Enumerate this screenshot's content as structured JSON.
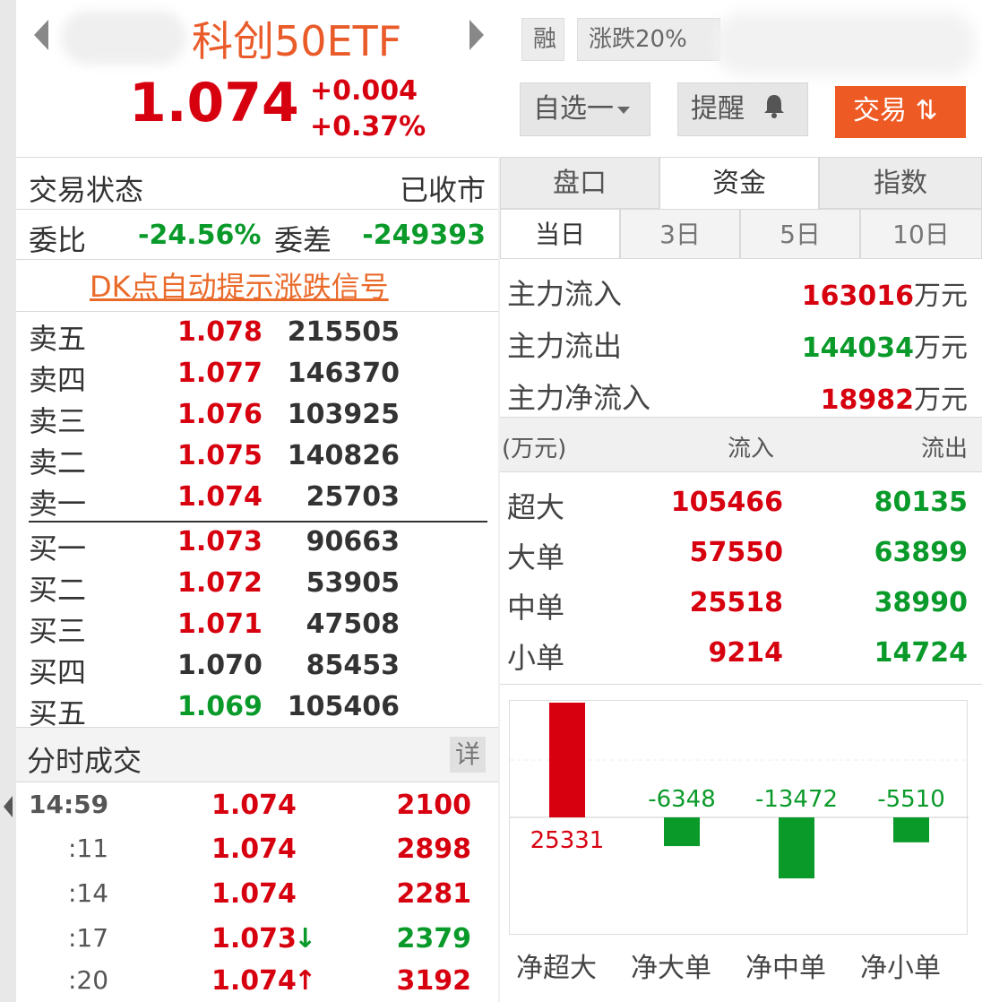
{
  "header": {
    "stock_name": "科创50ETF",
    "price": "1.074",
    "change_abs": "+0.004",
    "change_pct": "+0.37%",
    "tag_rong": "融",
    "tag_zhangdie": "涨跌20%",
    "watchlist_label": "自选一",
    "remind_label": "提醒",
    "trade_label": "交易 ⇅"
  },
  "status": {
    "trade_status_label": "交易状态",
    "trade_status_value": "已收市",
    "weibi_label": "委比",
    "weibi_value": "-24.56%",
    "weicha_label": "委差",
    "weicha_value": "-249393"
  },
  "dk_link": "DK点自动提示涨跌信号",
  "orderbook": {
    "sell": [
      {
        "name": "卖五",
        "price": "1.078",
        "vol": "215505"
      },
      {
        "name": "卖四",
        "price": "1.077",
        "vol": "146370"
      },
      {
        "name": "卖三",
        "price": "1.076",
        "vol": "103925"
      },
      {
        "name": "卖二",
        "price": "1.075",
        "vol": "140826"
      },
      {
        "name": "卖一",
        "price": "1.074",
        "vol": "25703"
      }
    ],
    "buy": [
      {
        "name": "买一",
        "price": "1.073",
        "vol": "90663"
      },
      {
        "name": "买二",
        "price": "1.072",
        "vol": "53905"
      },
      {
        "name": "买三",
        "price": "1.071",
        "vol": "47508"
      },
      {
        "name": "买四",
        "price": "1.070",
        "vol": "85453"
      },
      {
        "name": "买五",
        "price": "1.069",
        "vol": "105406"
      }
    ]
  },
  "ticks": {
    "title": "分时成交",
    "detail_label": "详",
    "rows": [
      {
        "time": "14:59",
        "price": "1.074",
        "vol": "2100"
      },
      {
        "time": ":11",
        "price": "1.074",
        "vol": "2898"
      },
      {
        "time": ":14",
        "price": "1.074",
        "vol": "2281"
      },
      {
        "time": ":17",
        "price": "1.073",
        "vol": "2379"
      },
      {
        "time": ":20",
        "price": "1.074",
        "vol": "3192"
      }
    ]
  },
  "tabs": [
    "盘口",
    "资金",
    "指数"
  ],
  "subtabs": [
    "当日",
    "3日",
    "5日",
    "10日"
  ],
  "flow": {
    "inflow_label": "主力流入",
    "inflow_value": "163016",
    "outflow_label": "主力流出",
    "outflow_value": "144034",
    "net_label": "主力净流入",
    "net_value": "18982",
    "unit": "万元"
  },
  "flow_table": {
    "unit_header": "(万元)",
    "in_header": "流入",
    "out_header": "流出",
    "rows": [
      {
        "label": "超大",
        "in": "105466",
        "out": "80135"
      },
      {
        "label": "大单",
        "in": "57550",
        "out": "63899"
      },
      {
        "label": "中单",
        "in": "25518",
        "out": "38990"
      },
      {
        "label": "小单",
        "in": "9214",
        "out": "14724"
      }
    ]
  },
  "chart_data": {
    "type": "bar",
    "categories": [
      "净超大",
      "净大单",
      "净中单",
      "净小单"
    ],
    "values": [
      25331,
      -6348,
      -13472,
      -5510
    ],
    "colors": {
      "positive": "#d7000f",
      "negative": "#0a9a2a"
    },
    "title": "",
    "xlabel": "",
    "ylabel": ""
  },
  "colors": {
    "up": "#d7000f",
    "down": "#0a9a2a",
    "accent": "#ea5b2a",
    "trade_button": "#ee5a24"
  }
}
